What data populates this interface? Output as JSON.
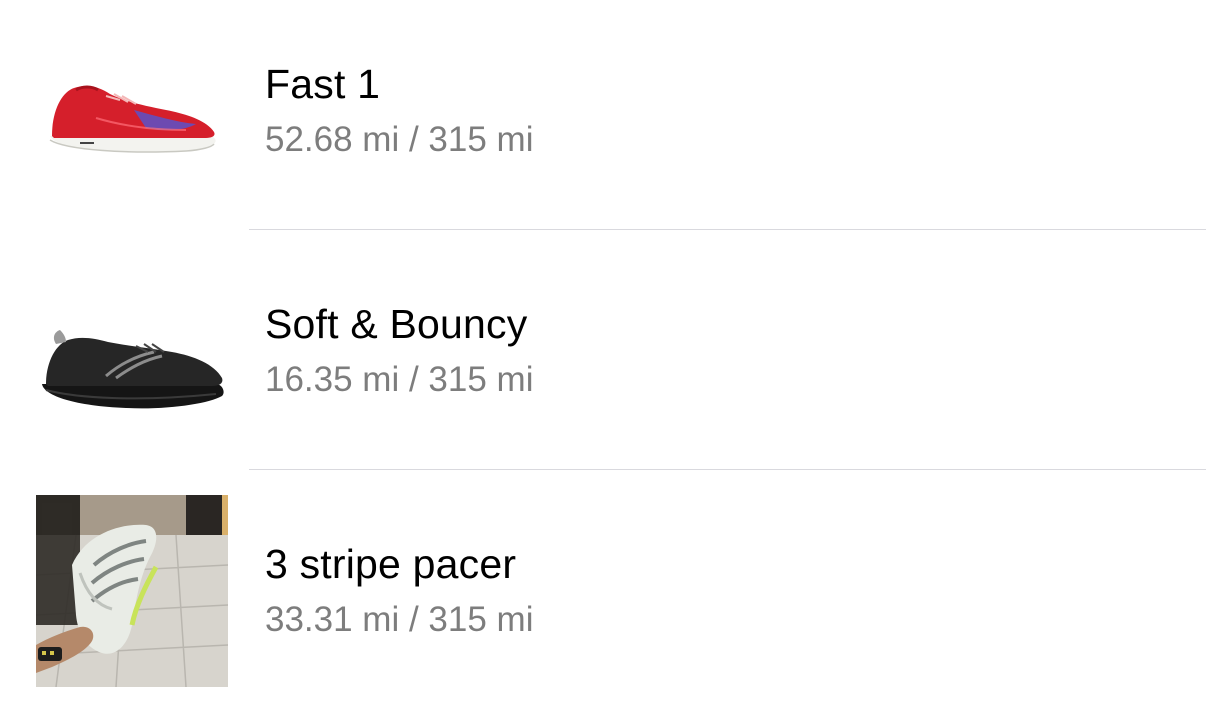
{
  "shoes": [
    {
      "name": "Fast 1",
      "distance": "52.68 mi / 315 mi",
      "image": "red-running-shoe"
    },
    {
      "name": "Soft & Bouncy",
      "distance": "16.35 mi / 315 mi",
      "image": "black-running-shoe"
    },
    {
      "name": "3 stripe pacer",
      "distance": "33.31 mi / 315 mi",
      "image": "white-shoe-photo"
    }
  ],
  "colors": {
    "title": "#000000",
    "subtitle": "#7d7d7d",
    "divider": "#d9d9de"
  }
}
